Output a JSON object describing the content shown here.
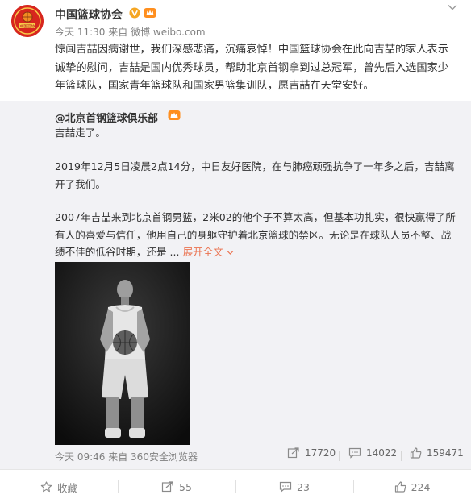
{
  "post": {
    "author": "中国篮球协会",
    "avatar_text": "中国篮协",
    "time": "今天 11:30",
    "source_prefix": "来自",
    "source": "微博 weibo.com",
    "text": "惊闻吉喆因病谢世，我们深感悲痛，沉痛哀悼！中国篮球协会在此向吉喆的家人表示诚挚的慰问，吉喆是国内优秀球员，帮助北京首钢拿到过总冠军，曾先后入选国家少年篮球队，国家青年篮球队和国家男篮集训队，愿吉喆在天堂安好。"
  },
  "repost": {
    "author": "@北京首钢篮球俱乐部",
    "line1": "吉喆走了。",
    "para2": "2019年12月5日凌晨2点14分，中日友好医院，在与肺癌顽强抗争了一年多之后，吉喆离开了我们。",
    "para3": "2007年吉喆来到北京首钢男篮，2米02的他个子不算太高，但基本功扎实，很快赢得了所有人的喜爱与信任，他用自己的身躯守护着北京篮球的禁区。无论是在球队人员不整、战绩不佳的低谷时期，还是 ...",
    "expand_label": "展开全文",
    "footer_time": "今天 09:46",
    "footer_source": "来自 360安全浏览器",
    "reposts": "17720",
    "comments": "14022",
    "likes": "159471"
  },
  "actions": {
    "favorite": "收藏",
    "repost": "55",
    "comment": "23",
    "like": "224"
  },
  "colors": {
    "link": "#eb7350",
    "repost_bg": "#f2f2f5",
    "avatar_red": "#d7261e",
    "verified_gold": "#f5a623"
  },
  "icons": [
    "verified-v-icon",
    "vip-crown-icon",
    "chevron-down-icon",
    "share-icon",
    "comment-icon",
    "like-icon",
    "star-icon"
  ]
}
